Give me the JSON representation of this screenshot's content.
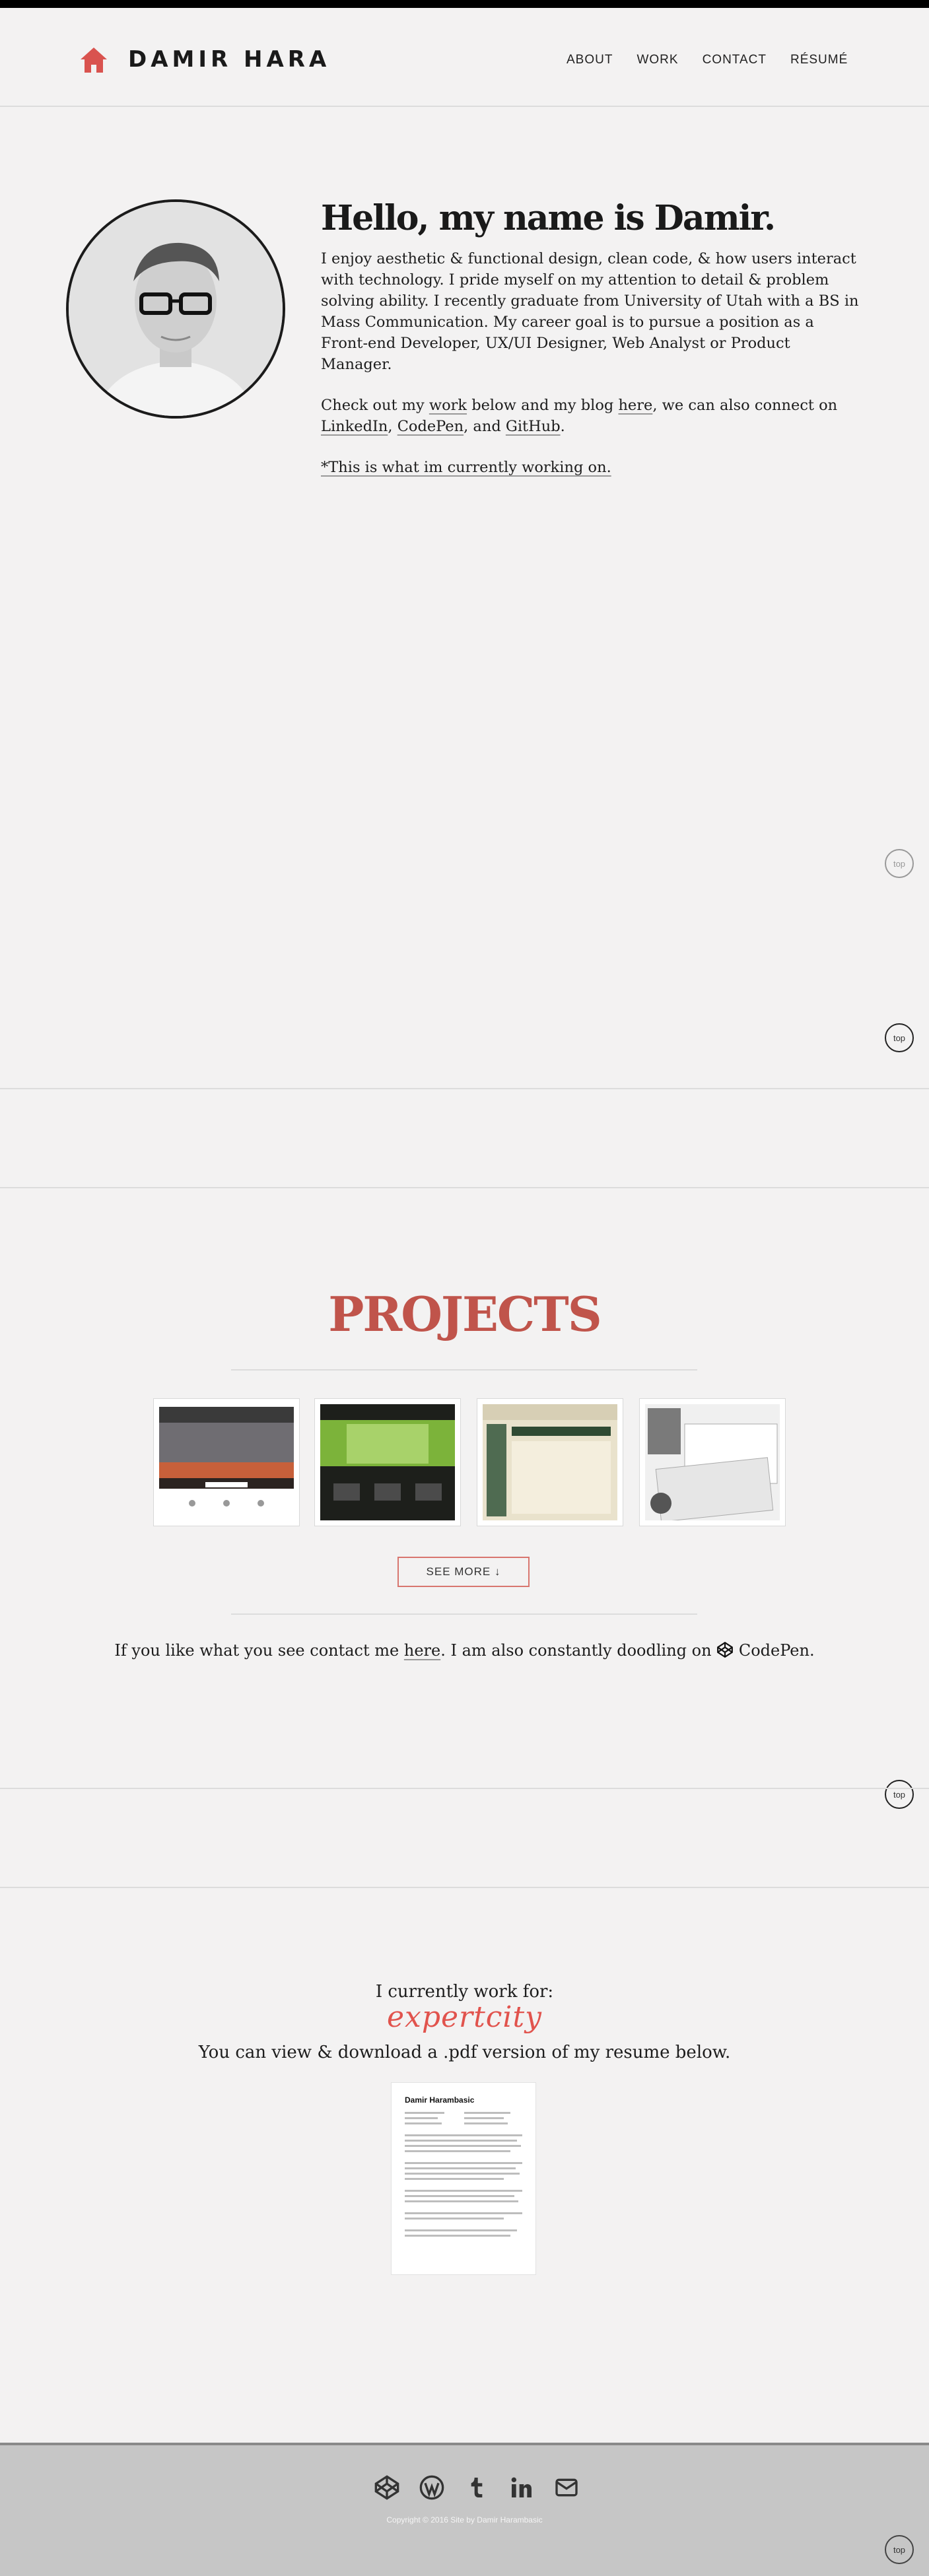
{
  "header": {
    "brand": "DAMIR HARA",
    "nav": [
      "ABOUT",
      "WORK",
      "CONTACT",
      "RÉSUMÉ"
    ]
  },
  "about": {
    "heading": "Hello, my name is Damir.",
    "p1": "I enjoy aesthetic & functional design, clean code, & how users interact with technology. I pride myself on my attention to detail & problem solving ability. I recently graduate from University of Utah with a BS in Mass Communication. My career goal is to pursue a position as a Front-end Developer, UX/UI Designer, Web Analyst or Product Manager.",
    "p2_a": "Check out my ",
    "p2_work": "work",
    "p2_b": " below and my blog ",
    "p2_here": "here",
    "p2_c": ", we can also connect on ",
    "p2_linkedin": "LinkedIn",
    "p2_sep": ", ",
    "p2_codepen": "CodePen",
    "p2_and": ", and ",
    "p2_github": "GitHub",
    "p2_end": ".",
    "current": "*This is what im currently working on."
  },
  "totop_label": "top",
  "projects": {
    "title": "PROJECTS",
    "see_more": "SEE MORE ↓",
    "contact_a": "If you like what you see contact me ",
    "contact_here": "here",
    "contact_b": ". I am also constantly doodling on ",
    "contact_codepen": "CodePen."
  },
  "resume": {
    "work_for": "I currently work for:",
    "company": "expertcity",
    "view": "You can view & download a .pdf version of my resume below.",
    "doc_title": "Damir Harambasic"
  },
  "footer": {
    "social_icons": [
      "codepen-icon",
      "wordpress-icon",
      "tumblr-icon",
      "linkedin-icon",
      "mail-icon"
    ],
    "copyright": "Copyright © 2016 Site by Damir Harambasic"
  },
  "colors": {
    "accent": "#c0544b",
    "logo": "#d9534f"
  }
}
